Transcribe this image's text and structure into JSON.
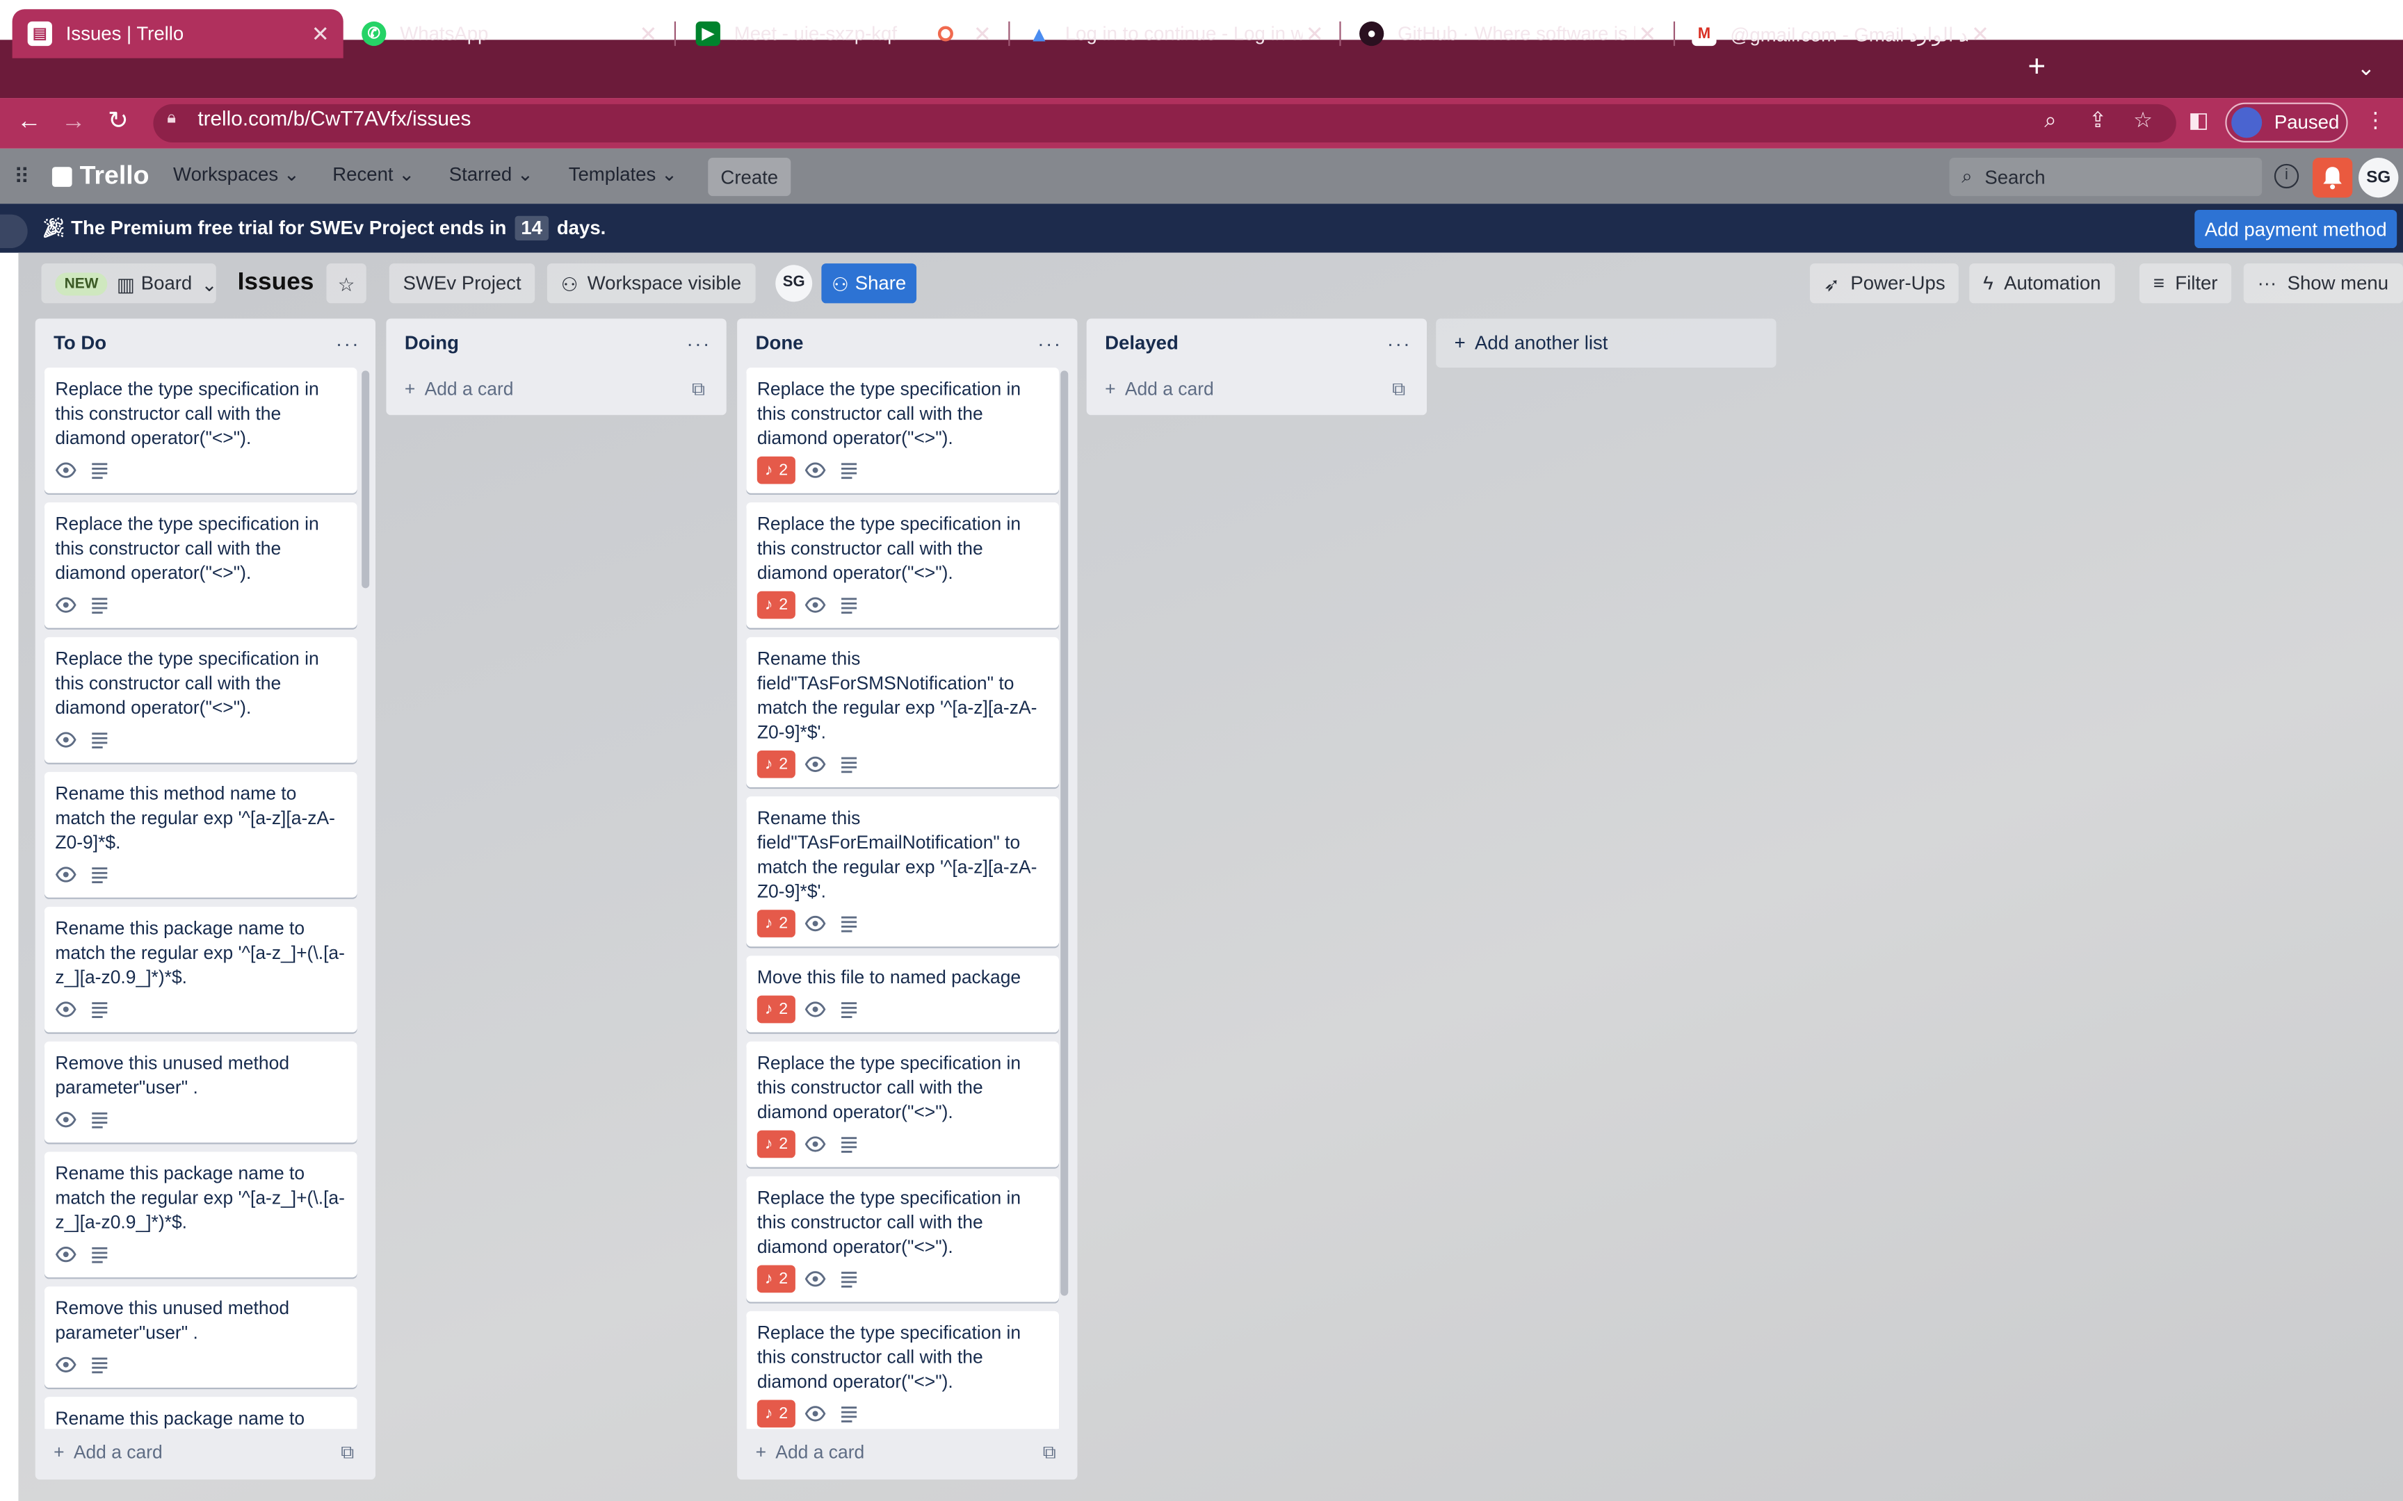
{
  "browser": {
    "tabs": [
      {
        "title": "Issues | Trello",
        "active": true
      },
      {
        "title": "WhatsApp",
        "active": false
      },
      {
        "title": "Meet - uie-sxzp-kqf",
        "active": false
      },
      {
        "title": "Log in to continue - Log in with",
        "active": false
      },
      {
        "title": "GitHub · Where software is buil",
        "active": false
      },
      {
        "title": "@gmail.com - Gmail البريد الوارد",
        "active": false
      }
    ],
    "url": "trello.com/b/CwT7AVfx/issues",
    "profile_status": "Paused"
  },
  "trello_header": {
    "logo": "Trello",
    "nav": [
      "Workspaces",
      "Recent",
      "Starred",
      "Templates"
    ],
    "create_label": "Create",
    "search_placeholder": "Search",
    "avatar_initials": "SG"
  },
  "banner": {
    "text_before": "The Premium free trial for SWEv Project ends in",
    "days": "14",
    "text_after": "days.",
    "button": "Add payment method"
  },
  "board_bar": {
    "new_tag": "NEW",
    "view": "Board",
    "title": "Issues",
    "workspace": "SWEv Project",
    "visibility": "Workspace visible",
    "member_initials": "SG",
    "share": "Share",
    "powerups": "Power-Ups",
    "automation": "Automation",
    "filter": "Filter",
    "show_menu": "Show menu"
  },
  "lists": [
    {
      "title": "To Do",
      "add_card": "Add a card",
      "cards": [
        {
          "text": "Replace the type specification in this constructor call with the diamond operator(\"<>\").",
          "notifications": null
        },
        {
          "text": "Replace the type specification in this constructor call with the diamond operator(\"<>\").",
          "notifications": null
        },
        {
          "text": "Replace the type specification in this constructor call with the diamond operator(\"<>\").",
          "notifications": null
        },
        {
          "text": "Rename this method name to match the regular exp '^[a-z][a-zA-Z0-9]*$.",
          "notifications": null
        },
        {
          "text": "Rename this package name to match the regular exp '^[a-z_]+(\\.[a-z_][a-z0.9_]*)*$.",
          "notifications": null
        },
        {
          "text": "Remove this unused method parameter\"user\" .",
          "notifications": null
        },
        {
          "text": "Rename this package name to match the regular exp '^[a-z_]+(\\.[a-z_][a-z0.9_]*)*$.",
          "notifications": null
        },
        {
          "text": "Remove this unused method parameter\"user\" .",
          "notifications": null
        },
        {
          "text": "Rename this package name to",
          "notifications": null
        }
      ]
    },
    {
      "title": "Doing",
      "add_card": "Add a card",
      "cards": []
    },
    {
      "title": "Done",
      "add_card": "Add a card",
      "cards": [
        {
          "text": "Replace the type specification in this constructor call with the diamond operator(\"<>\").",
          "notifications": "2"
        },
        {
          "text": "Replace the type specification in this constructor call with the diamond operator(\"<>\").",
          "notifications": "2"
        },
        {
          "text": "Rename this field\"TAsForSMSNotification\" to match the regular exp '^[a-z][a-zA-Z0-9]*$'.",
          "notifications": "2"
        },
        {
          "text": "Rename this field\"TAsForEmailNotification\" to match the regular exp '^[a-z][a-zA-Z0-9]*$'.",
          "notifications": "2"
        },
        {
          "text": "Move this file to named package",
          "notifications": "2"
        },
        {
          "text": "Replace the type specification in this constructor call with the diamond operator(\"<>\").",
          "notifications": "2"
        },
        {
          "text": "Replace the type specification in this constructor call with the diamond operator(\"<>\").",
          "notifications": "2"
        },
        {
          "text": "Replace the type specification in this constructor call with the diamond operator(\"<>\").",
          "notifications": "2"
        }
      ]
    },
    {
      "title": "Delayed",
      "add_card": "Add a card",
      "cards": []
    }
  ],
  "add_list": "Add another list",
  "colors": {
    "tab_strip": "#6c1b3a",
    "tab_active": "#b0305d",
    "banner": "#1d2b4c",
    "primary_button": "#2d73d4",
    "notification_badge": "#e55a4a"
  }
}
